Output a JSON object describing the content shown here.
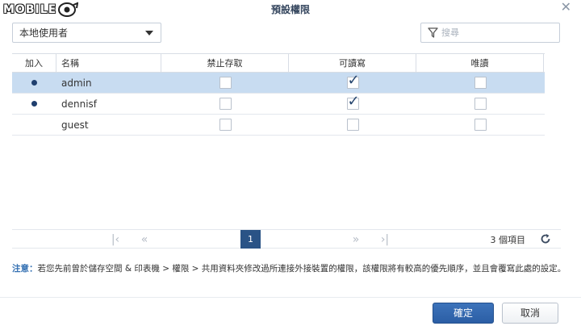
{
  "watermark": {
    "text": "MOBILE"
  },
  "dialog": {
    "title": "預設權限",
    "close_icon": "close-icon"
  },
  "user_select": {
    "value": "本地使用者"
  },
  "filter": {
    "placeholder": "搜尋"
  },
  "table": {
    "headers": {
      "join": "加入",
      "name": "名稱",
      "deny": "禁止存取",
      "rw": "可讀寫",
      "ro": "唯讀"
    },
    "rows": [
      {
        "name": "admin",
        "joined": true,
        "deny": false,
        "rw": true,
        "ro": false,
        "selected": true
      },
      {
        "name": "dennisf",
        "joined": true,
        "deny": false,
        "rw": true,
        "ro": false,
        "selected": false
      },
      {
        "name": "guest",
        "joined": false,
        "deny": false,
        "rw": false,
        "ro": false,
        "selected": false
      }
    ]
  },
  "pager": {
    "first": "|<",
    "prev": "<<",
    "current": "1",
    "next": ">>",
    "last": ">|",
    "count": "3 個項目"
  },
  "note": {
    "label": "注意：",
    "text": "若您先前曾於儲存空間 & 印表機 > 權限 > 共用資料夾修改過所連接外接裝置的權限，該權限將有較高的優先順序，並且會覆寫此處的設定。"
  },
  "buttons": {
    "ok": "確定",
    "cancel": "取消"
  },
  "colors": {
    "primary": "#2a5386",
    "selected_row": "#c8dcf1",
    "note_label": "#3571b3"
  }
}
